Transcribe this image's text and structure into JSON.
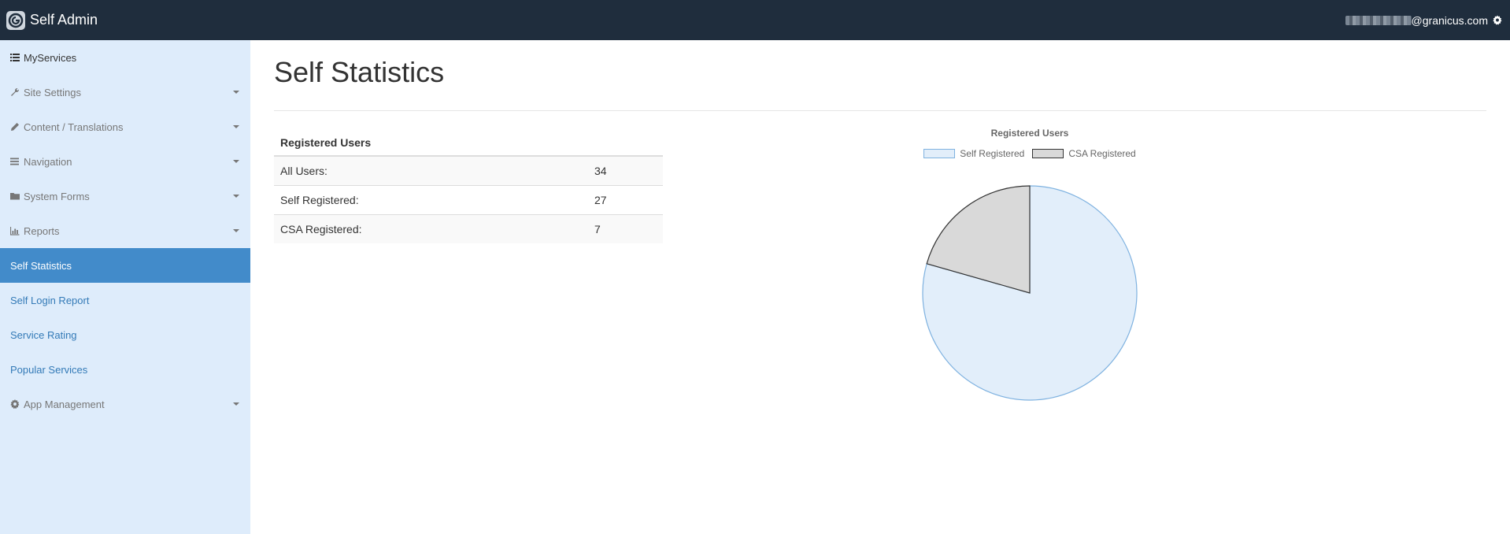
{
  "header": {
    "title": "Self Admin",
    "user_email_suffix": "@granicus.com"
  },
  "sidebar": {
    "items": [
      {
        "label": "MyServices",
        "icon": "list-icon"
      },
      {
        "label": "Site Settings",
        "icon": "wrench-icon",
        "has_caret": true
      },
      {
        "label": "Content / Translations",
        "icon": "pencil-icon",
        "has_caret": true
      },
      {
        "label": "Navigation",
        "icon": "bars-icon",
        "has_caret": true
      },
      {
        "label": "System Forms",
        "icon": "folder-icon",
        "has_caret": true
      },
      {
        "label": "Reports",
        "icon": "chart-icon",
        "has_caret": true
      },
      {
        "label": "Self Statistics",
        "active": true
      },
      {
        "label": "Self Login Report"
      },
      {
        "label": "Service Rating"
      },
      {
        "label": "Popular Services"
      },
      {
        "label": "App Management",
        "icon": "gear-icon",
        "has_caret": true
      }
    ]
  },
  "main": {
    "title": "Self Statistics",
    "table": {
      "header": "Registered Users",
      "rows": [
        {
          "label": "All Users:",
          "value": "34"
        },
        {
          "label": "Self Registered:",
          "value": "27"
        },
        {
          "label": "CSA Registered:",
          "value": "7"
        }
      ]
    }
  },
  "chart_data": {
    "type": "pie",
    "title": "Registered Users",
    "labels": [
      "Self Registered",
      "CSA Registered"
    ],
    "values": [
      27,
      7
    ],
    "colors": [
      "#e2eefa",
      "#d9d9d9"
    ],
    "border_colors": [
      "#7fb2e0",
      "#333333"
    ],
    "legend": "top"
  }
}
